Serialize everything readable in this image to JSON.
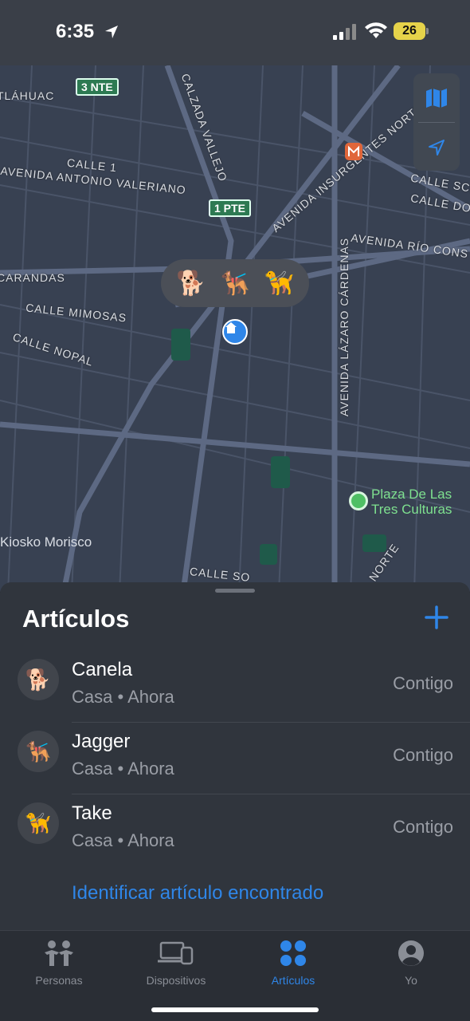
{
  "status_bar": {
    "time": "6:35",
    "battery": "26",
    "colors": {
      "battery": "#e6d34a"
    }
  },
  "map": {
    "street_labels": [
      "TLÁHUAC",
      "CALZADA VALLEJO",
      "AVENIDA INSURGENTES NORTE",
      "CALLE 1",
      "AVENIDA ANTONIO VALERIANO",
      "CARANDAS",
      "CALLE MIMOSAS",
      "CALLE NOPAL",
      "AVENIDA LÁZARO CÁRDENAS",
      "AVENIDA RÍO CONS",
      "CALLE SCH",
      "CALLE DOI",
      "CALLE SO",
      "NORTE"
    ],
    "route_shields": [
      "3 NTE",
      "1 PTE"
    ],
    "places": {
      "plaza": "Plaza De Las\nTres Culturas",
      "kiosko": "Kiosko Morisco"
    },
    "pets_bubble": [
      "🐕",
      "🐕‍🦺",
      "🦮"
    ],
    "controls": [
      "map-icon",
      "location-arrow-icon"
    ]
  },
  "sheet": {
    "title": "Artículos",
    "add_icon": "plus-icon",
    "items": [
      {
        "avatar": "🐕",
        "name": "Canela",
        "subtitle": "Casa • Ahora",
        "status": "Contigo"
      },
      {
        "avatar": "🐕‍🦺",
        "name": "Jagger",
        "subtitle": "Casa • Ahora",
        "status": "Contigo"
      },
      {
        "avatar": "🦮",
        "name": "Take",
        "subtitle": "Casa • Ahora",
        "status": "Contigo"
      }
    ],
    "identify_link": "Identificar artículo encontrado"
  },
  "tabbar": {
    "tabs": [
      {
        "label": "Personas",
        "icon": "people-icon"
      },
      {
        "label": "Dispositivos",
        "icon": "devices-icon"
      },
      {
        "label": "Artículos",
        "icon": "items-grid-icon",
        "active": true
      },
      {
        "label": "Yo",
        "icon": "person-circle-icon"
      }
    ],
    "colors": {
      "active": "#2f86e8",
      "inactive": "#8a8e96"
    }
  }
}
